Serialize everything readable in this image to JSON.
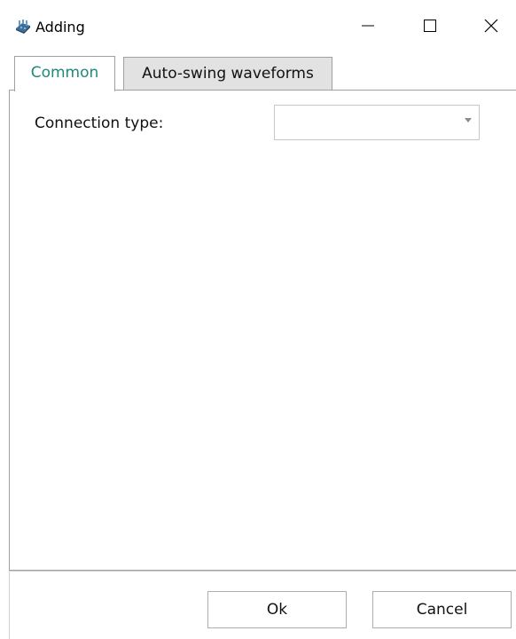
{
  "window": {
    "title": "Adding",
    "app_icon": "app-icon"
  },
  "caption_buttons": {
    "minimize": "minimize-icon",
    "maximize": "maximize-icon",
    "close": "close-icon"
  },
  "tabs": [
    {
      "label": "Common",
      "active": true
    },
    {
      "label": "Auto-swing waveforms",
      "active": false
    }
  ],
  "form": {
    "connection_type_label": "Connection type:",
    "connection_type_value": ""
  },
  "buttons": {
    "ok_label": "Ok",
    "cancel_label": "Cancel"
  },
  "colors": {
    "active_tab_text": "#1f8a7a",
    "inactive_tab_bg": "#e2e2e2",
    "border": "#a0a0a0"
  }
}
